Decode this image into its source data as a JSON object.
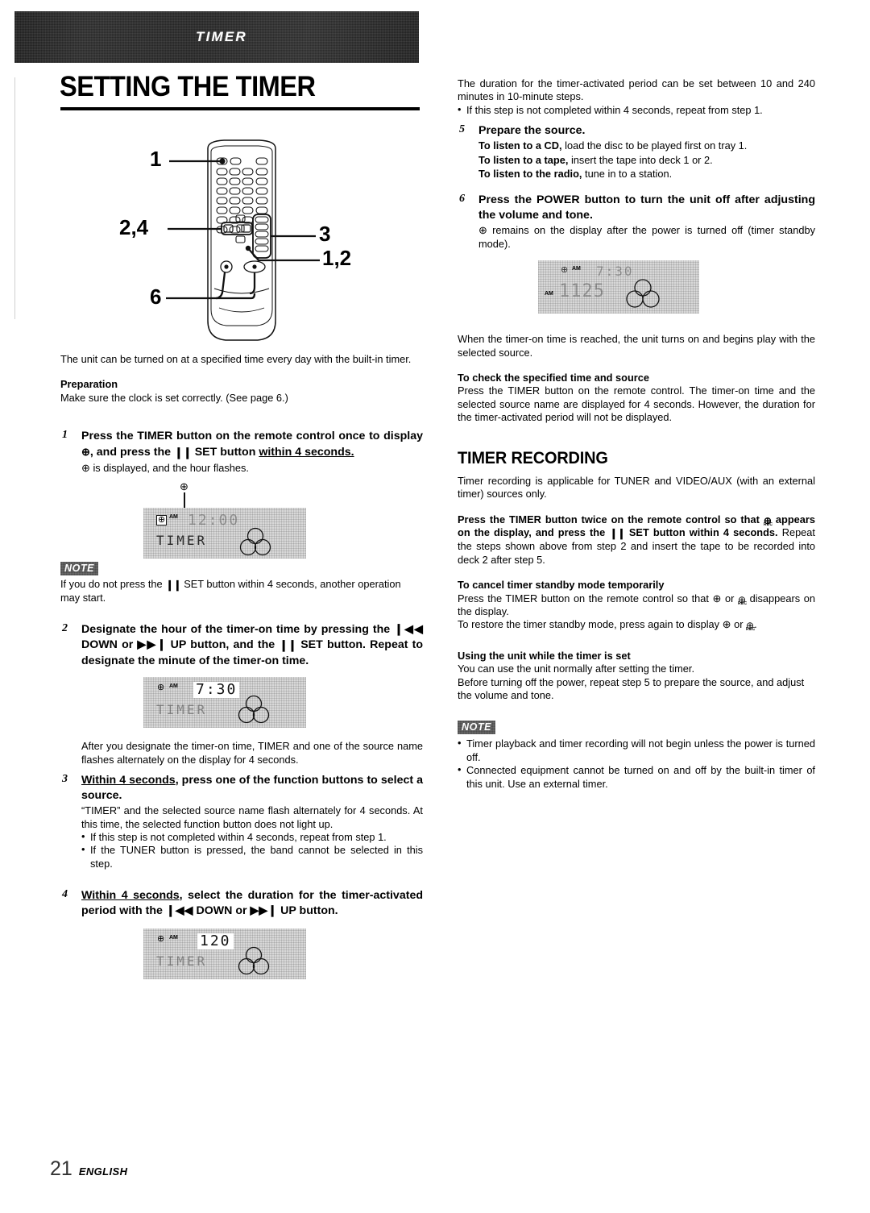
{
  "banner": {
    "label": "TIMER"
  },
  "page_title": "SETTING THE TIMER",
  "footer": {
    "page_number": "21",
    "language": "ENGLISH"
  },
  "remote_diagram": {
    "callouts": [
      {
        "id": "callout-1",
        "label": "1"
      },
      {
        "id": "callout-2-4",
        "label": "2,4"
      },
      {
        "id": "callout-3",
        "label": "3"
      },
      {
        "id": "callout-1-2",
        "label": "1,2"
      },
      {
        "id": "callout-6",
        "label": "6"
      }
    ]
  },
  "left": {
    "intro": "The unit can be turned on at a specified time every day with the built-in timer.",
    "preparation_heading": "Preparation",
    "preparation_text": "Make sure the clock is set correctly. (See page 6.)",
    "step1": {
      "num": "1",
      "head_a": "Press the TIMER button on the remote control once to display ",
      "head_clock": "⊕",
      "head_b": ", and press the ",
      "head_pause": "❙❙",
      "head_c": " SET button ",
      "head_underlined": "within 4 seconds.",
      "body_clock": "⊕",
      "body": " is displayed, and the hour flashes.",
      "lcd": {
        "clock_icon": "⊕",
        "am": "AM",
        "digits": "12:00",
        "word": "TIMER",
        "discs": "3-disc-icon"
      },
      "note_badge": "NOTE",
      "note_a": "If you do not press the ",
      "note_pause": "❙❙",
      "note_b": " SET button within 4 seconds, another operation may start."
    },
    "step2": {
      "num": "2",
      "head_a": "Designate the hour of the timer-on time by pressing the ",
      "head_rew": "❙◀◀",
      "head_b": " DOWN or ",
      "head_ff": "▶▶❙",
      "head_c": " UP button, and the ",
      "head_pause": "❙❙",
      "head_d": " SET button. Repeat to designate the minute of the timer-on time.",
      "lcd": {
        "clock_icon": "⊕",
        "am": "AM",
        "digits": "7:30",
        "word": "TIMER",
        "discs": "3-disc-icon"
      },
      "body": "After you designate the timer-on time, TIMER and one of the source name flashes alternately on the display for 4 seconds."
    },
    "step3": {
      "num": "3",
      "head_underlined": "Within 4 seconds",
      "head_rest": ", press one of the function buttons to select a source.",
      "body": "“TIMER” and the selected source name flash alternately for 4 seconds.  At this time, the selected function button does not light up.",
      "bullets": [
        "If this step is not completed within 4 seconds, repeat from step 1.",
        "If the TUNER button is pressed, the band cannot be selected in this step."
      ]
    },
    "step4": {
      "num": "4",
      "head_underlined": "Within 4 seconds",
      "head_a": ", select the duration for the timer-activated period with the ",
      "head_rew": "❙◀◀",
      "head_b": " DOWN or ",
      "head_ff": "▶▶❙",
      "head_c": " UP button.",
      "lcd": {
        "clock_icon": "⊕",
        "am": "AM",
        "digits": "120",
        "word": "TIMER",
        "discs": "3-disc-icon"
      }
    }
  },
  "right": {
    "top_para": "The duration for the timer-activated period can be set between 10 and 240 minutes in 10-minute steps.",
    "top_bullet": "If this step is not completed within 4 seconds, repeat from step 1.",
    "step5": {
      "num": "5",
      "head": "Prepare the source.",
      "lines": [
        {
          "bold": "To listen to a CD,",
          "rest": " load the disc to be played first on tray 1."
        },
        {
          "bold": "To listen to a tape,",
          "rest": " insert the tape into deck 1 or 2."
        },
        {
          "bold": "To listen to the radio,",
          "rest": " tune in to a station."
        }
      ]
    },
    "step6": {
      "num": "6",
      "head": "Press the POWER button to turn the unit off after adjusting the volume and tone.",
      "body_clock": "⊕",
      "body": " remains on the display after the power is turned off (timer standby mode).",
      "lcd": {
        "clock_icon": "⊕",
        "am_top": "AM",
        "digits_top": "7:30",
        "am_left": "AM",
        "digits_main": "1125",
        "discs": "3-disc-icon"
      },
      "after": "When the timer-on time is reached, the unit turns on and begins play with the selected source."
    },
    "check_heading": "To check the specified time and source",
    "check_body": "Press the TIMER button on the remote control. The timer-on time and the selected source name are displayed for 4 seconds. However, the duration for the timer-activated period will not be displayed.",
    "timer_recording": {
      "heading": "TIMER RECORDING",
      "intro": "Timer recording is applicable for TUNER and VIDEO/AUX (with an external timer) sources only.",
      "press_a": "Press the TIMER button twice on the remote control so that ",
      "press_rec": "⊕",
      "press_rec_sub": "REC",
      "press_b": " appears on the display, and press the ",
      "press_pause": "❙❙",
      "press_c": " SET button within 4 seconds.",
      "press_rest": "  Repeat the steps shown above from step 2 and insert the tape to be recorded into deck 2 after step 5.",
      "cancel_heading": "To cancel timer standby mode temporarily",
      "cancel_a": "Press the TIMER button on the remote control so that ",
      "cancel_clock": "⊕",
      "cancel_b": " or ",
      "cancel_rec": "⊕",
      "cancel_rec_sub": "REC",
      "cancel_c": " disappears on the display.",
      "restore_a": "To restore the timer standby mode, press again to display ",
      "restore_clock": "⊕",
      "restore_b": " or ",
      "restore_rec": "⊕",
      "restore_rec_sub": "REC",
      "restore_c": ".",
      "using_heading": "Using the unit while the timer is set",
      "using_body": "You can use the unit normally after setting the timer.\nBefore turning off the power, repeat step 5 to prepare the source, and adjust the volume and tone.",
      "note_badge": "NOTE",
      "note_bullets": [
        "Timer playback and timer recording will not begin unless the power is turned off.",
        "Connected equipment cannot be turned on and off by the built-in timer of this unit.  Use an external timer."
      ]
    }
  }
}
